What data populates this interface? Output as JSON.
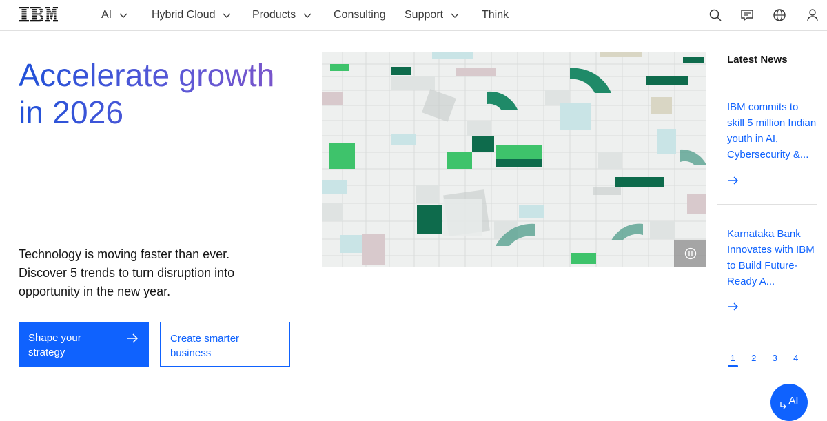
{
  "header": {
    "logo_text": "IBM",
    "nav": [
      {
        "label": "AI",
        "has_dropdown": true
      },
      {
        "label": "Hybrid Cloud",
        "has_dropdown": true
      },
      {
        "label": "Products",
        "has_dropdown": true
      },
      {
        "label": "Consulting",
        "has_dropdown": false
      },
      {
        "label": "Support",
        "has_dropdown": true
      },
      {
        "label": "Think",
        "has_dropdown": false
      }
    ],
    "icons": [
      "search-icon",
      "chat-icon",
      "globe-icon",
      "user-icon"
    ]
  },
  "hero": {
    "title": "Accelerate growth in 2026",
    "body": "Technology is moving faster than ever. Discover 5 trends to turn disruption into opportunity in the new year.",
    "primary_button": "Shape your strategy",
    "secondary_button": "Create smarter business",
    "media_control": "pause-icon"
  },
  "news": {
    "heading": "Latest News",
    "items": [
      {
        "text": "IBM commits to skill 5 million Indian youth in AI, Cybersecurity &..."
      },
      {
        "text": "Karnataka Bank Innovates with IBM to Build Future-Ready A..."
      }
    ],
    "pages": [
      "1",
      "2",
      "3",
      "4"
    ],
    "active_page": "1"
  },
  "ai_button": {
    "label": "AI"
  },
  "colors": {
    "primary": "#0f62fe",
    "title_gradient_start": "#2152d9",
    "title_gradient_end": "#8354c7",
    "tile_green": "#42be65",
    "tile_dark_green": "#0e6b4c"
  }
}
